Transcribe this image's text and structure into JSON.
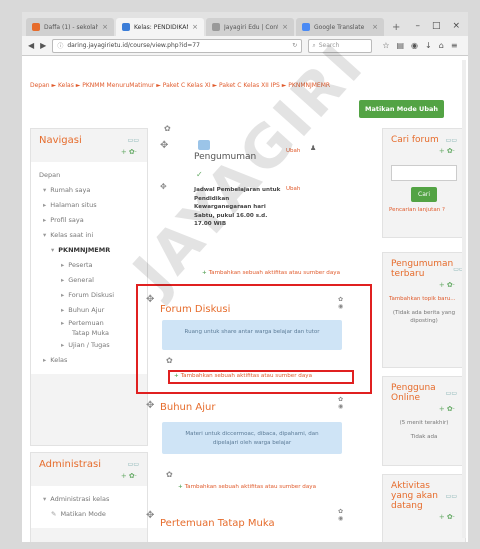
{
  "browser": {
    "tabs": [
      {
        "label": "Daffa (1) - sekolahjayagi...",
        "color": "#e66c2c",
        "active": false
      },
      {
        "label": "Kelas: PENDIDIKAN K...",
        "color": "#3b7dd8",
        "active": true
      },
      {
        "label": "Jayagiri Edu | Content M...",
        "color": "#999999",
        "active": false
      },
      {
        "label": "Google Translate",
        "color": "#4a8af4",
        "active": false
      }
    ],
    "url": "daring.jayagirietu.id/course/view.php?id=77",
    "search_placeholder": "Search"
  },
  "breadcrumb": "Depan  ►  Kelas  ►  PKNMM MenuruMatimur  ►  Paket C Kelas XI  ►  Paket C Kelas XII IPS  ►  PKNMNJMEMR",
  "edit_button": "Matikan Mode Ubah",
  "navigation": {
    "title": "Navigasi",
    "items": [
      {
        "label": "Depan",
        "indent": 0,
        "arrow": ""
      },
      {
        "label": "Rumah saya",
        "indent": 1,
        "arrow": "▾"
      },
      {
        "label": "Halaman situs",
        "indent": 1,
        "arrow": "▸"
      },
      {
        "label": "Profil saya",
        "indent": 1,
        "arrow": "▸"
      },
      {
        "label": "Kelas saat ini",
        "indent": 1,
        "arrow": "▾"
      },
      {
        "label": "PKNMNJMEMR",
        "indent": 2,
        "arrow": "▾"
      },
      {
        "label": "Peserta",
        "indent": 3,
        "arrow": "▸"
      },
      {
        "label": "General",
        "indent": 3,
        "arrow": "▸"
      },
      {
        "label": "Forum Diskusi",
        "indent": 3,
        "arrow": "▸"
      },
      {
        "label": "Buhun Ajur",
        "indent": 3,
        "arrow": "▸"
      },
      {
        "label": "Pertemuan",
        "indent": 3,
        "arrow": "▸"
      },
      {
        "label": "Tatap Muka",
        "indent": 3,
        "arrow": ""
      },
      {
        "label": "Ujian / Tugas",
        "indent": 3,
        "arrow": "▸"
      },
      {
        "label": "Kelas",
        "indent": 1,
        "arrow": "▸"
      }
    ]
  },
  "administration": {
    "title": "Administrasi",
    "items": [
      "Administrasi kelas",
      "Matikan Mode"
    ]
  },
  "center": {
    "announcement": "Pengumuman",
    "schedule": "Jadwal Pembelajaran untuk Pendidikan Kewarganegaraan hari Sabtu, pukul 16.00 s.d. 17.00 WIB",
    "edit_label": "Ubah",
    "add_activity": "Tambahkan sebuah aktifitas atau sumber daya",
    "sections": [
      {
        "title": "Forum Diskusi",
        "info": "Ruang untuk share antar warga belajar dan tutor"
      },
      {
        "title": "Buhun Ajur",
        "info": "Materi untuk diccermoac, dibaca, dipahami, dan dipelajari oleh warga belajar"
      },
      {
        "title": "Pertemuan Tatap Muka",
        "info": ""
      }
    ]
  },
  "right": {
    "forum_title": "Cari forum",
    "search_button": "Cari",
    "advanced_search": "Pencarian lanjutan",
    "news_title": "Pengumuman terbaru",
    "news_link": "Tambahkan topik baru...",
    "news_empty": "(Tidak ada berita yang diposting)",
    "online_title": "Pengguna Online",
    "online_info": "(5 menit terakhir)",
    "online_none": "Tidak ada",
    "activity_title": "Aktivitas yang akan datang"
  },
  "watermark": "JAYAGIRI",
  "icons": [
    "gear-icon",
    "plus-icon",
    "user-icon",
    "eye-icon",
    "help-icon"
  ]
}
